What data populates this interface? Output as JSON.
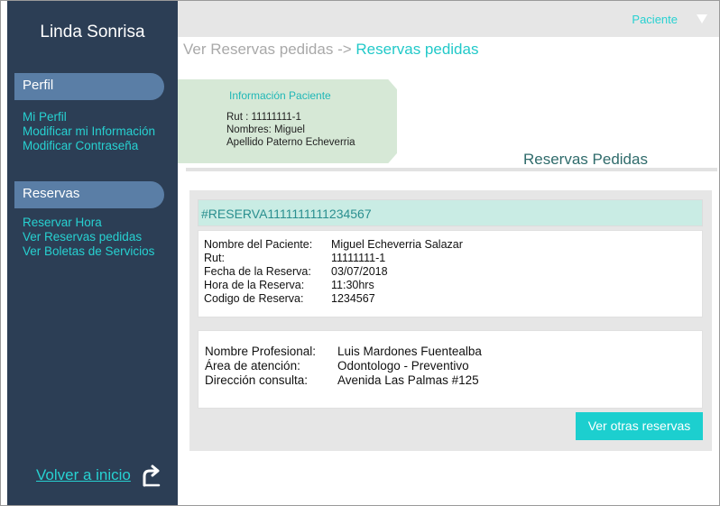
{
  "sidebar": {
    "brand": "Linda Sonrisa",
    "perfil": {
      "title": "Perfil",
      "links": [
        "Mi Perfil",
        "Modificar mi Información",
        "Modificar Contraseña"
      ]
    },
    "reservas": {
      "title": "Reservas",
      "links": [
        "Reservar Hora",
        "Ver Reservas pedidas",
        "Ver Boletas de Servicios"
      ]
    },
    "home_label": "Volver a inicio"
  },
  "topbar": {
    "user_label": "Paciente"
  },
  "breadcrumb": {
    "previous": "Ver Reservas pedidas",
    "separator": "->",
    "current": "Reservas pedidas"
  },
  "patient": {
    "title": "Información Paciente",
    "lines": [
      "Rut : 11111111-1",
      "Nombres: Miguel",
      "Apellido Paterno Echeverria"
    ]
  },
  "section_title": "Reservas Pedidas",
  "reservation": {
    "code_header": "#RESERVA1111111111234567",
    "details": [
      {
        "label": "Nombre del Paciente:",
        "value": "Miguel Echeverria Salazar"
      },
      {
        "label": "Rut:",
        "value": "11111111-1"
      },
      {
        "label": "Fecha de la Reserva:",
        "value": "03/07/2018"
      },
      {
        "label": "Hora de la Reserva:",
        "value": "11:30hrs"
      },
      {
        "label": "Codigo de Reserva:",
        "value": "1234567"
      }
    ],
    "professional": [
      {
        "label": "Nombre Profesional:",
        "value": "Luis Mardones Fuentealba"
      },
      {
        "label": "Área de atención:",
        "value": "Odontologo - Preventivo"
      },
      {
        "label": "Dirección consulta:",
        "value": "Avenida Las Palmas #125"
      }
    ],
    "button_label": "Ver otras reservas"
  },
  "colors": {
    "sidebar": "#2c3e55",
    "accent": "#27d1d1",
    "pill": "#5a7ea6",
    "patient_card": "#d6e8d6"
  }
}
